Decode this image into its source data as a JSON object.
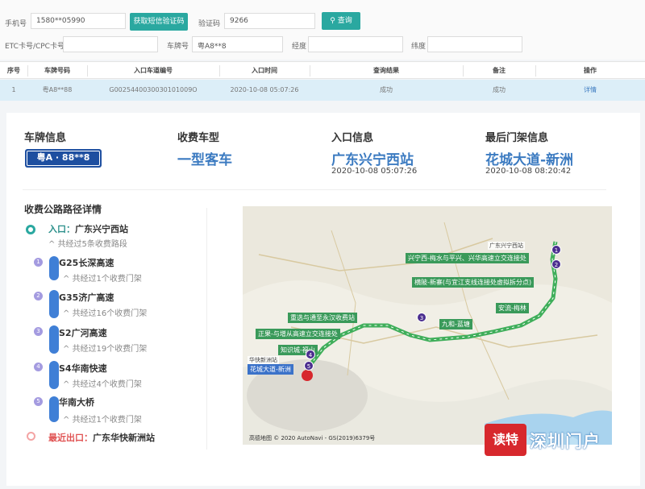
{
  "form": {
    "phone_label": "手机号",
    "phone_value": "1580**05990",
    "get_code_button": "获取短信验证码",
    "code_label": "验证码",
    "code_value": "9266",
    "query_button": "查询",
    "etc_label": "ETC卡号/CPC卡号",
    "plate_label": "车牌号",
    "plate_value": "粤A8**8",
    "longitude_label": "经度",
    "latitude_label": "纬度"
  },
  "table": {
    "headers": [
      "序号",
      "车牌号码",
      "入口车道编号",
      "入口时间",
      "查询结果",
      "备注",
      "操作"
    ],
    "row": {
      "index": "1",
      "plate": "粤A8**88",
      "lane": "G0025440030030101009O",
      "time": "2020-10-08 05:07:26",
      "result": "成功",
      "remark": "成功",
      "action": "详情"
    }
  },
  "detail": {
    "plate_info_label": "车牌信息",
    "plate_badge": "粤A · 88**8",
    "vehicle_type_label": "收费车型",
    "vehicle_type": "一型客车",
    "entry_info_label": "入口信息",
    "entry_station": "广东兴宁西站",
    "entry_time": "2020-10-08 05:07:26",
    "gantry_info_label": "最后门架信息",
    "gantry_station": "花城大道-新洲",
    "gantry_time": "2020-10-08 08:20:42"
  },
  "route": {
    "title": "收费公路路径详情",
    "entry_prefix": "入口：",
    "entry_name": "广东兴宁西站",
    "entry_sub": "共经过5条收费路段",
    "segments": [
      {
        "num": "1",
        "name": "G25长深高速",
        "sub": "共经过1个收费门架"
      },
      {
        "num": "2",
        "name": "G35济广高速",
        "sub": "共经过16个收费门架"
      },
      {
        "num": "3",
        "name": "S2广河高速",
        "sub": "共经过19个收费门架"
      },
      {
        "num": "4",
        "name": "S4华南快速",
        "sub": "共经过4个收费门架"
      },
      {
        "num": "5",
        "name": "华南大桥",
        "sub": "共经过1个收费门架"
      }
    ],
    "exit_prefix": "最近出口：",
    "exit_name": "广东华快新洲站"
  },
  "map": {
    "labels": {
      "xingning_west": "广东兴宁西站",
      "xingning_hub": "兴宁西-梅水与平兴、兴华高速立交连接处",
      "hengbei": "横陂-新寨(与宜江支线连接处虚拟拆分点)",
      "anliu": "安流-梅林",
      "jiuhe": "九和-蓝塘",
      "zengcheng": "重选与通至永汉收费站",
      "zhengguo": "正果-与增从高速立交连接处",
      "zhixin": "知识城-福山",
      "huakuai": "华快新洲站",
      "huacheng": "花城大道-新洲"
    },
    "pins": [
      "1",
      "2",
      "3",
      "4",
      "5"
    ],
    "copyright": "高德地图 © 2020 AutoNavi - GS(2019)6379号"
  },
  "watermark": {
    "badge": "读特",
    "text": "深圳门户"
  },
  "colors": {
    "teal": "#2aa8a0",
    "blue": "#3c7bc1",
    "route_green": "#3fae5a",
    "pin_purple": "#4b2e8f"
  }
}
